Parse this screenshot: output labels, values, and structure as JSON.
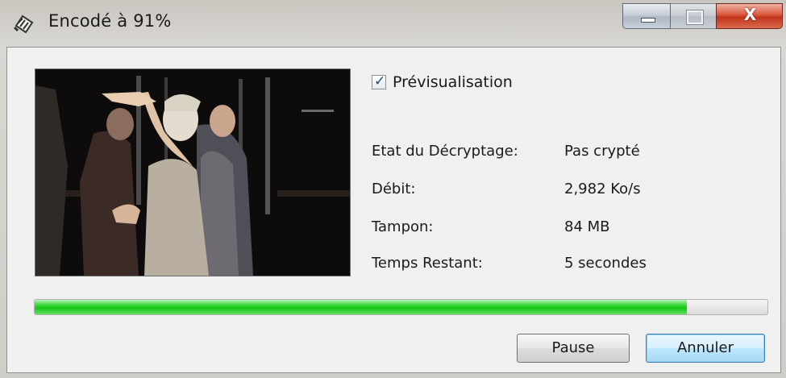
{
  "window": {
    "title": "Encodé à 91%",
    "app_icon": "clapperboard-icon"
  },
  "caption_buttons": {
    "minimize_icon": "minimize-icon",
    "maximize_icon": "maximize-icon",
    "close_glyph": "X"
  },
  "preview": {
    "checkbox_label": "Prévisualisation",
    "checked": true,
    "check_glyph": "✓"
  },
  "info": {
    "rows": [
      {
        "label": "Etat du Décryptage:",
        "value": "Pas crypté"
      },
      {
        "label": "Débit:",
        "value": "2,982 Ko/s"
      },
      {
        "label": "Tampon:",
        "value": "84 MB"
      },
      {
        "label": "Temps Restant:",
        "value": "5 secondes"
      }
    ]
  },
  "progress": {
    "fraction": 0.89,
    "color": "#1ec81e"
  },
  "buttons": {
    "pause": "Pause",
    "cancel": "Annuler"
  }
}
